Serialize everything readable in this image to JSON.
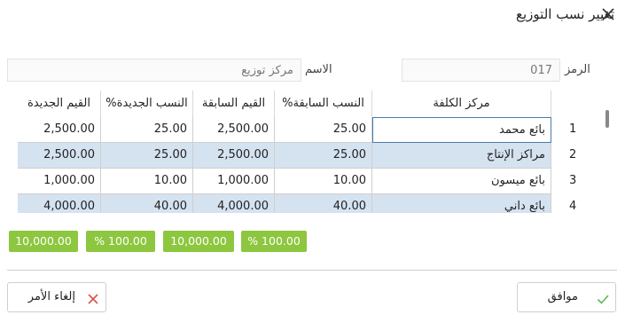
{
  "window": {
    "title": "تغيير نسب التوزيع"
  },
  "form": {
    "code_label": "الرمز",
    "code_value": "017",
    "name_label": "الاسم",
    "name_value": "مركز توزيع"
  },
  "grid": {
    "columns": {
      "cost_center": "مركز الكلفة",
      "prev_pct": "النسب السابقة%",
      "prev_values": "القيم السابقة",
      "new_pct": "النسب الجديدة%",
      "new_values": "القيم الجديدة"
    },
    "rows": [
      {
        "index": "1",
        "name": "بائع محمد",
        "prev_pct": "25.00",
        "prev_values": "2,500.00",
        "new_pct": "25.00",
        "new_values": "2,500.00"
      },
      {
        "index": "2",
        "name": "مراكز الإنتاج",
        "prev_pct": "25.00",
        "prev_values": "2,500.00",
        "new_pct": "25.00",
        "new_values": "2,500.00"
      },
      {
        "index": "3",
        "name": "بائع ميسون",
        "prev_pct": "10.00",
        "prev_values": "1,000.00",
        "new_pct": "10.00",
        "new_values": "1,000.00"
      },
      {
        "index": "4",
        "name": "بائع داني",
        "prev_pct": "40.00",
        "prev_values": "4,000.00",
        "new_pct": "40.00",
        "new_values": "4,000.00"
      }
    ]
  },
  "totals": {
    "new_values_total": "10,000.00",
    "new_pct_total": "% 100.00",
    "prev_values_total": "10,000.00",
    "prev_pct_total": "% 100.00"
  },
  "buttons": {
    "cancel_label": "إلغاء الأمر",
    "ok_label": "موافق"
  },
  "colors": {
    "totals_bg": "#8dc63f",
    "alt_row_bg": "#d5e2f0",
    "ok_check": "#5cb85c",
    "cancel_x": "#d9534f"
  }
}
